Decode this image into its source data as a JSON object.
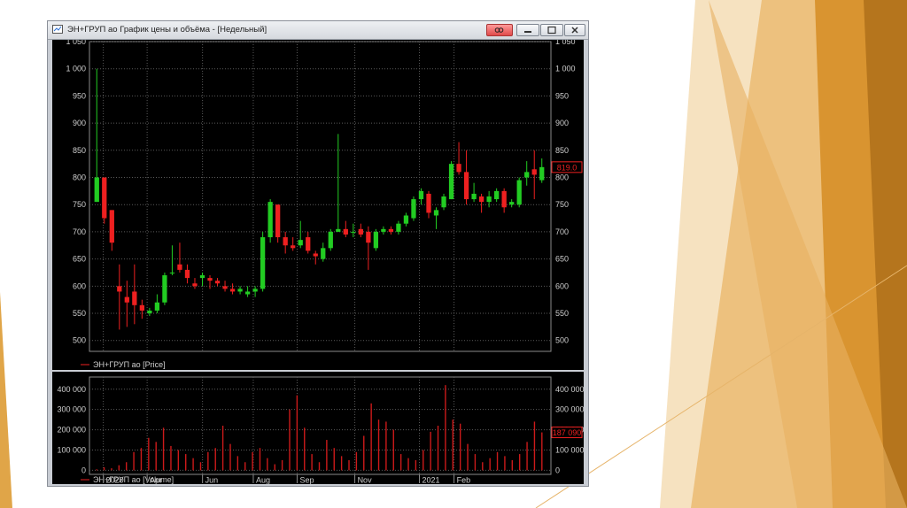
{
  "window": {
    "title": "ЭН+ГРУП ао График цены и объёма - [Недельный]"
  },
  "colors": {
    "background": "#000000",
    "grid": "#5a5a5a",
    "up_candle": "#22cc22",
    "down_candle": "#ee2020",
    "volume": "#cc1a1a",
    "axis_text": "#cfcfcf",
    "marker": "#ee2020"
  },
  "chart_data": [
    {
      "type": "candlestick",
      "legend": "ЭН+ГРУП ао [Price]",
      "ylim": [
        480,
        1050
      ],
      "yticks": [
        500,
        550,
        600,
        650,
        700,
        750,
        800,
        850,
        900,
        950,
        1000,
        1050
      ],
      "ytick_labels": [
        "500",
        "550",
        "600",
        "650",
        "700",
        "750",
        "800",
        "850",
        "900",
        "950",
        "1 000",
        "1 050"
      ],
      "last_value_label": "819.0",
      "last_value": 819,
      "grid": true,
      "candles": [
        {
          "o": 755,
          "h": 1000,
          "l": 755,
          "c": 800
        },
        {
          "o": 800,
          "h": 800,
          "l": 715,
          "c": 725
        },
        {
          "o": 740,
          "h": 740,
          "l": 665,
          "c": 680
        },
        {
          "o": 600,
          "h": 640,
          "l": 520,
          "c": 590
        },
        {
          "o": 580,
          "h": 610,
          "l": 525,
          "c": 570
        },
        {
          "o": 590,
          "h": 640,
          "l": 530,
          "c": 565
        },
        {
          "o": 565,
          "h": 575,
          "l": 540,
          "c": 555
        },
        {
          "o": 550,
          "h": 560,
          "l": 545,
          "c": 555
        },
        {
          "o": 555,
          "h": 585,
          "l": 550,
          "c": 570
        },
        {
          "o": 570,
          "h": 625,
          "l": 565,
          "c": 620
        },
        {
          "o": 625,
          "h": 675,
          "l": 620,
          "c": 625
        },
        {
          "o": 640,
          "h": 680,
          "l": 625,
          "c": 630
        },
        {
          "o": 630,
          "h": 640,
          "l": 605,
          "c": 615
        },
        {
          "o": 605,
          "h": 615,
          "l": 595,
          "c": 600
        },
        {
          "o": 615,
          "h": 625,
          "l": 600,
          "c": 620
        },
        {
          "o": 615,
          "h": 620,
          "l": 595,
          "c": 610
        },
        {
          "o": 610,
          "h": 615,
          "l": 600,
          "c": 605
        },
        {
          "o": 600,
          "h": 610,
          "l": 590,
          "c": 595
        },
        {
          "o": 595,
          "h": 605,
          "l": 585,
          "c": 590
        },
        {
          "o": 590,
          "h": 600,
          "l": 585,
          "c": 595
        },
        {
          "o": 585,
          "h": 600,
          "l": 580,
          "c": 590
        },
        {
          "o": 590,
          "h": 600,
          "l": 580,
          "c": 595
        },
        {
          "o": 595,
          "h": 700,
          "l": 590,
          "c": 690
        },
        {
          "o": 690,
          "h": 760,
          "l": 680,
          "c": 755
        },
        {
          "o": 750,
          "h": 750,
          "l": 680,
          "c": 690
        },
        {
          "o": 690,
          "h": 700,
          "l": 660,
          "c": 675
        },
        {
          "o": 675,
          "h": 690,
          "l": 665,
          "c": 670
        },
        {
          "o": 675,
          "h": 720,
          "l": 670,
          "c": 685
        },
        {
          "o": 690,
          "h": 700,
          "l": 660,
          "c": 665
        },
        {
          "o": 660,
          "h": 665,
          "l": 640,
          "c": 655
        },
        {
          "o": 650,
          "h": 680,
          "l": 645,
          "c": 670
        },
        {
          "o": 670,
          "h": 705,
          "l": 665,
          "c": 700
        },
        {
          "o": 700,
          "h": 880,
          "l": 700,
          "c": 705
        },
        {
          "o": 705,
          "h": 720,
          "l": 690,
          "c": 695
        },
        {
          "o": 700,
          "h": 715,
          "l": 690,
          "c": 700
        },
        {
          "o": 705,
          "h": 715,
          "l": 690,
          "c": 695
        },
        {
          "o": 700,
          "h": 710,
          "l": 630,
          "c": 680
        },
        {
          "o": 670,
          "h": 705,
          "l": 665,
          "c": 700
        },
        {
          "o": 700,
          "h": 710,
          "l": 695,
          "c": 705
        },
        {
          "o": 705,
          "h": 710,
          "l": 695,
          "c": 700
        },
        {
          "o": 700,
          "h": 720,
          "l": 695,
          "c": 715
        },
        {
          "o": 715,
          "h": 735,
          "l": 710,
          "c": 730
        },
        {
          "o": 725,
          "h": 765,
          "l": 720,
          "c": 760
        },
        {
          "o": 760,
          "h": 780,
          "l": 750,
          "c": 775
        },
        {
          "o": 770,
          "h": 775,
          "l": 725,
          "c": 735
        },
        {
          "o": 730,
          "h": 745,
          "l": 705,
          "c": 740
        },
        {
          "o": 745,
          "h": 770,
          "l": 740,
          "c": 765
        },
        {
          "o": 760,
          "h": 830,
          "l": 760,
          "c": 825
        },
        {
          "o": 825,
          "h": 865,
          "l": 805,
          "c": 810
        },
        {
          "o": 810,
          "h": 850,
          "l": 750,
          "c": 760
        },
        {
          "o": 760,
          "h": 790,
          "l": 755,
          "c": 770
        },
        {
          "o": 765,
          "h": 770,
          "l": 735,
          "c": 755
        },
        {
          "o": 755,
          "h": 775,
          "l": 745,
          "c": 765
        },
        {
          "o": 760,
          "h": 780,
          "l": 755,
          "c": 775
        },
        {
          "o": 775,
          "h": 780,
          "l": 735,
          "c": 745
        },
        {
          "o": 750,
          "h": 760,
          "l": 745,
          "c": 755
        },
        {
          "o": 750,
          "h": 800,
          "l": 745,
          "c": 795
        },
        {
          "o": 800,
          "h": 830,
          "l": 785,
          "c": 810
        },
        {
          "o": 815,
          "h": 850,
          "l": 760,
          "c": 805
        },
        {
          "o": 795,
          "h": 835,
          "l": 790,
          "c": 819
        }
      ]
    },
    {
      "type": "bar",
      "legend": "ЭН+ГРУП ао [Volume]",
      "ylim": [
        -20000,
        460000
      ],
      "yticks": [
        0,
        100000,
        200000,
        300000,
        400000
      ],
      "ytick_labels": [
        "0",
        "100 000",
        "200 000",
        "300 000",
        "400 000"
      ],
      "last_value_label": "187 090",
      "last_value": 187090,
      "grid": true,
      "values": [
        5000,
        15000,
        10000,
        25000,
        40000,
        90000,
        110000,
        160000,
        140000,
        210000,
        120000,
        100000,
        80000,
        60000,
        40000,
        90000,
        110000,
        220000,
        130000,
        70000,
        40000,
        90000,
        110000,
        60000,
        30000,
        50000,
        300000,
        370000,
        210000,
        80000,
        40000,
        150000,
        110000,
        70000,
        50000,
        90000,
        170000,
        330000,
        250000,
        240000,
        200000,
        80000,
        60000,
        50000,
        100000,
        190000,
        220000,
        420000,
        250000,
        230000,
        130000,
        80000,
        40000,
        60000,
        90000,
        70000,
        50000,
        80000,
        140000,
        240000,
        187090
      ]
    }
  ],
  "time_axis": {
    "labels": [
      "2020",
      "Apr",
      "Jun",
      "Aug",
      "Sep",
      "Nov",
      "2021",
      "Feb"
    ],
    "positions": [
      0.03,
      0.125,
      0.245,
      0.355,
      0.45,
      0.575,
      0.715,
      0.79
    ]
  }
}
